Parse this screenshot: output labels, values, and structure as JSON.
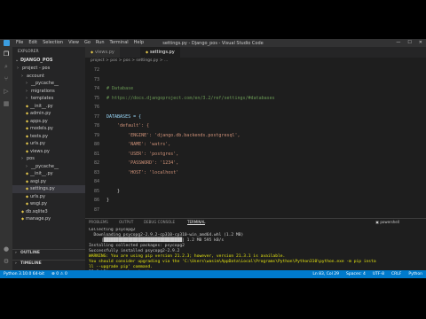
{
  "window": {
    "title": "settings.py - Django_pos - Visual Studio Code",
    "menu": [
      "File",
      "Edit",
      "Selection",
      "View",
      "Go",
      "Run",
      "Terminal",
      "Help"
    ]
  },
  "sidebar": {
    "header": "EXPLORER",
    "project": "DJANGO_POS",
    "items": [
      {
        "label": "project - pos",
        "depth": 1,
        "folder": true
      },
      {
        "label": "account",
        "depth": 2,
        "folder": true
      },
      {
        "label": "__pycache__",
        "depth": 3,
        "folder": true
      },
      {
        "label": "migrations",
        "depth": 3,
        "folder": true
      },
      {
        "label": "templates",
        "depth": 3,
        "folder": true
      },
      {
        "label": "__init__.py",
        "depth": 3,
        "folder": false
      },
      {
        "label": "admin.py",
        "depth": 3,
        "folder": false
      },
      {
        "label": "apps.py",
        "depth": 3,
        "folder": false
      },
      {
        "label": "models.py",
        "depth": 3,
        "folder": false
      },
      {
        "label": "tests.py",
        "depth": 3,
        "folder": false
      },
      {
        "label": "urls.py",
        "depth": 3,
        "folder": false
      },
      {
        "label": "views.py",
        "depth": 3,
        "folder": false
      },
      {
        "label": "pos",
        "depth": 2,
        "folder": true
      },
      {
        "label": "__pycache__",
        "depth": 3,
        "folder": true
      },
      {
        "label": "__init__.py",
        "depth": 3,
        "folder": false
      },
      {
        "label": "asgi.py",
        "depth": 3,
        "folder": false
      },
      {
        "label": "settings.py",
        "depth": 3,
        "folder": false,
        "active": true
      },
      {
        "label": "urls.py",
        "depth": 3,
        "folder": false
      },
      {
        "label": "wsgi.py",
        "depth": 3,
        "folder": false
      },
      {
        "label": "db.sqlite3",
        "depth": 2,
        "folder": false
      },
      {
        "label": "manage.py",
        "depth": 2,
        "folder": false
      }
    ],
    "outline": "OUTLINE",
    "timeline": "TIMELINE"
  },
  "tabs": [
    {
      "label": "views.py",
      "active": false
    },
    {
      "label": "settings.py",
      "active": true
    }
  ],
  "breadcrumb": "project > pos > pos > settings.py > ...",
  "code": [
    {
      "n": "72",
      "text": ""
    },
    {
      "n": "73",
      "text": ""
    },
    {
      "n": "74",
      "text": "# Database",
      "cls": "cm"
    },
    {
      "n": "75",
      "text": "# https://docs.djangoproject.com/en/3.2/ref/settings/#databases",
      "cls": "cm"
    },
    {
      "n": "76",
      "text": ""
    },
    {
      "n": "77",
      "text": "DATABASES = {",
      "cls": "kw"
    },
    {
      "n": "78",
      "text": "    'default': {",
      "cls": "st"
    },
    {
      "n": "79",
      "text": "        'ENGINE': 'django.db.backends.postgresql',",
      "cls": "st"
    },
    {
      "n": "80",
      "text": "        'NAME': 'watrs',",
      "cls": "st"
    },
    {
      "n": "81",
      "text": "        'USER': 'postgres',",
      "cls": "st"
    },
    {
      "n": "82",
      "text": "        'PASSWORD': '1234',",
      "cls": "st"
    },
    {
      "n": "83",
      "text": "        'HOST': 'localhost'",
      "cls": "st"
    },
    {
      "n": "84",
      "text": ""
    },
    {
      "n": "85",
      "text": "    }"
    },
    {
      "n": "86",
      "text": "}"
    },
    {
      "n": "87",
      "text": ""
    }
  ],
  "panel": {
    "tabs": [
      "PROBLEMS",
      "OUTPUT",
      "DEBUG CONSOLE",
      "TERMINAL"
    ],
    "active_tab": "TERMINAL",
    "shell": "powershell",
    "terminal": [
      {
        "text": "Collecting psycopg2"
      },
      {
        "text": "  Downloading psycopg2-2.9.2-cp310-cp310-win_amd64.whl (1.2 MB)"
      },
      {
        "text": "     |████████████████████████████████| 1.2 MB 595 kB/s"
      },
      {
        "text": "Installing collected packages: psycopg2"
      },
      {
        "text": "Successfully installed psycopg2-2.9.2"
      },
      {
        "text": "WARNING: You are using pip version 21.2.3; however, version 21.3.1 is available.",
        "warn": true
      },
      {
        "text": "You should consider upgrading via the 'C:\\Users\\wasim\\AppData\\Local\\Programs\\Python\\Python310\\python.exe -m pip insta",
        "warn": true
      },
      {
        "text": "ll --upgrade pip' command.",
        "warn": true
      },
      {
        "text": "PS C:\\Django_pos\\project\\pos> "
      }
    ]
  },
  "status": {
    "left": [
      "Python 3.10.0 64-bit",
      "⊗ 0  ⚠ 0"
    ],
    "right": [
      "Ln 83, Col 29",
      "Spaces: 4",
      "UTF-8",
      "CRLF",
      "Python"
    ]
  }
}
